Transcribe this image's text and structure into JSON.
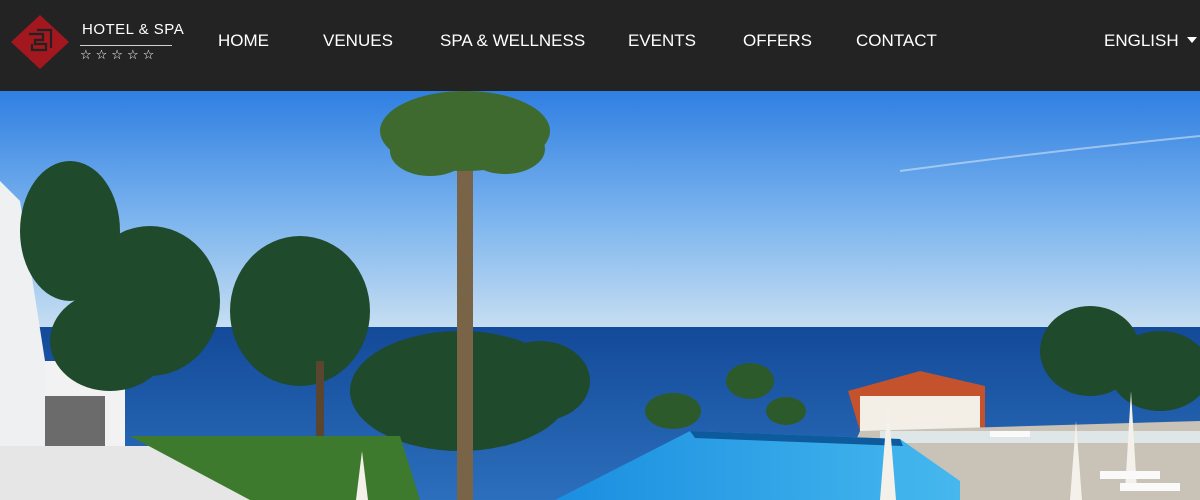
{
  "brand": {
    "name": "HOTEL & SPA",
    "stars": "☆☆☆☆☆",
    "accent_color": "#a3171f"
  },
  "nav": {
    "items": [
      {
        "label": "HOME"
      },
      {
        "label": "VENUES"
      },
      {
        "label": "SPA & WELLNESS"
      },
      {
        "label": "EVENTS"
      },
      {
        "label": "OFFERS"
      },
      {
        "label": "CONTACT"
      }
    ]
  },
  "language": {
    "selected": "ENGLISH",
    "icon": "caret-down-icon"
  },
  "hero": {
    "icon": "hero-photo"
  },
  "colors": {
    "header_bg": "#232323",
    "text": "#ffffff",
    "sky_top": "#2f7fe2",
    "sea": "#1e5aa8",
    "pool": "#1e8fd6"
  }
}
